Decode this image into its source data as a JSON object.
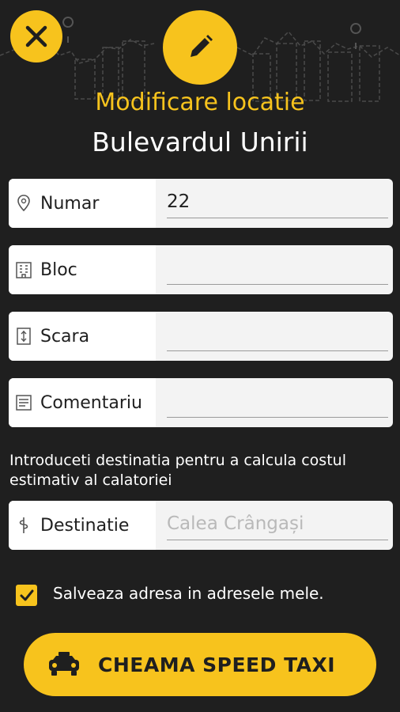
{
  "header": {
    "title": "Modificare locatie",
    "street": "Bulevardul Unirii"
  },
  "fields": [
    {
      "label": "Numar",
      "value": "22",
      "placeholder": "",
      "icon": "location-pin-icon"
    },
    {
      "label": "Bloc",
      "value": "",
      "placeholder": "",
      "icon": "building-icon"
    },
    {
      "label": "Scara",
      "value": "",
      "placeholder": "",
      "icon": "stairs-door-icon"
    },
    {
      "label": "Comentariu",
      "value": "",
      "placeholder": "",
      "icon": "note-icon"
    }
  ],
  "hint": "Introduceti destinatia pentru a calcula costul estimativ al calatoriei",
  "destination": {
    "label": "Destinatie",
    "value": "",
    "placeholder": "Calea Crângași",
    "icon": "route-icon"
  },
  "save_address": {
    "checked": true,
    "label": "Salveaza adresa in adresele mele."
  },
  "cta": {
    "label": "CHEAMA SPEED TAXI",
    "icon": "taxi-car-icon"
  },
  "colors": {
    "accent": "#f7c31d",
    "background": "#1f1f1f"
  }
}
